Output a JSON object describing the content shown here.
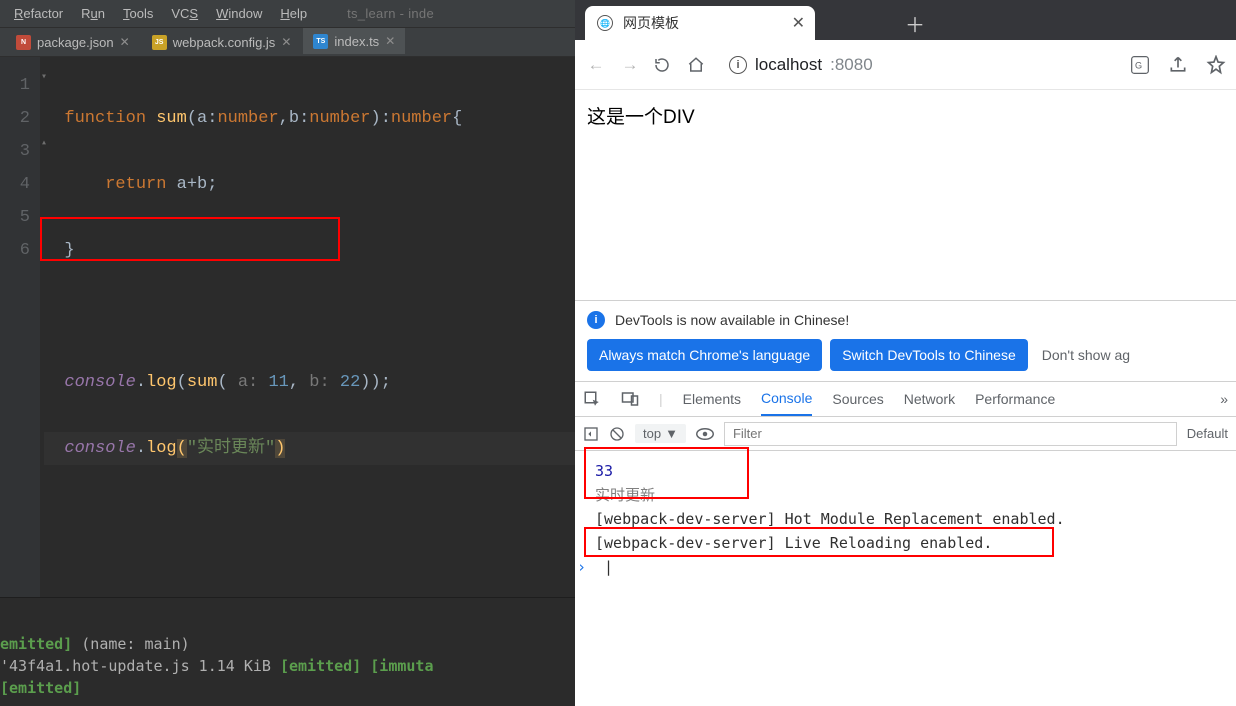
{
  "ide": {
    "menu": {
      "refactor": "Refactor",
      "run": "Run",
      "tools": "Tools",
      "vcs": "VCS",
      "window": "Window",
      "help": "Help"
    },
    "project_name": "ts_learn - inde",
    "tabs": {
      "pkg": {
        "label": "package.json"
      },
      "wcfg": {
        "label": "webpack.config.js"
      },
      "idx": {
        "label": "index.ts"
      }
    },
    "gutter": [
      "1",
      "2",
      "3",
      "4",
      "5",
      "6"
    ],
    "code": {
      "l1": {
        "fn": "function ",
        "name": "sum",
        "p1": "(a:",
        "t1": "number",
        "c1": ",b:",
        "t2": "number",
        "p2": "):",
        "t3": "number",
        "ob": "{"
      },
      "l2": {
        "ret": "return ",
        "expr": "a+b;"
      },
      "l3": {
        "close": "}"
      },
      "l5": {
        "obj": "console",
        "dot": ".",
        "call": "log",
        "open": "(",
        "fnname": "sum",
        "op2": "(",
        "h1": " a: ",
        "n1": "11",
        "comma": ", ",
        "h2": "b: ",
        "n2": "22",
        "cl2": "));"
      },
      "l6": {
        "obj": "console",
        "dot": ".",
        "call": "log",
        "open": "(",
        "str": "\"实时更新\"",
        "close": ")"
      }
    },
    "terminal": {
      "l1a": "emitted]",
      "l1b": " (name: main)",
      "l2a": "'43f4a1.hot-update.js 1.14 KiB ",
      "l2b": "[emitted]",
      "l2c": " ",
      "l2d": "[immuta",
      "l3": "[emitted]"
    }
  },
  "browser": {
    "tab_title": "网页模板",
    "address": {
      "host": "localhost",
      "port": ":8080"
    },
    "page_text": "这是一个DIV"
  },
  "devtools": {
    "info": "DevTools is now available in Chinese!",
    "btn1": "Always match Chrome's language",
    "btn2": "Switch DevTools to Chinese",
    "dont_show": "Don't show ag",
    "tabs": {
      "elements": "Elements",
      "console": "Console",
      "sources": "Sources",
      "network": "Network",
      "performance": "Performance"
    },
    "toolbar": {
      "top": "top",
      "filter_placeholder": "Filter",
      "default": "Default"
    },
    "out": {
      "v33": "33",
      "str": "实时更新",
      "hmr": "[webpack-dev-server] Hot Module Replacement enabled.",
      "live": "[webpack-dev-server] Live Reloading enabled."
    }
  }
}
